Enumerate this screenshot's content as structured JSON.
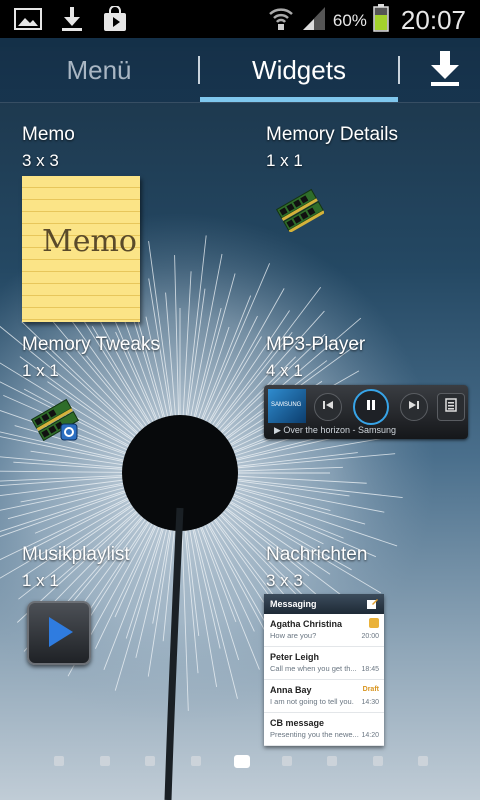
{
  "status_bar": {
    "battery_percent": "60%",
    "time": "20:07",
    "icons": [
      "gallery-icon",
      "download-icon",
      "store-bag-icon",
      "wifi-icon",
      "signal-icon",
      "battery-icon"
    ]
  },
  "tabs": [
    {
      "label": "Menü",
      "active": false
    },
    {
      "label": "Widgets",
      "active": true
    }
  ],
  "widgets": [
    {
      "title": "Memo",
      "size": "3 x 3",
      "preview_text": "Memo"
    },
    {
      "title": "Memory Details",
      "size": "1 x 1"
    },
    {
      "title": "Memory Tweaks",
      "size": "1 x 1"
    },
    {
      "title": "MP3-Player",
      "size": "4 x 1",
      "album_label": "SAMSUNG",
      "now_playing": "▶ Over the horizon - Samsung"
    },
    {
      "title": "Musikplaylist",
      "size": "1 x 1"
    },
    {
      "title": "Nachrichten",
      "size": "3 x 3",
      "app_title": "Messaging",
      "messages": [
        {
          "name": "Agatha Christina",
          "preview": "How are you?",
          "time": "20:00",
          "tag": ""
        },
        {
          "name": "Peter Leigh",
          "preview": "Call me when you get th...",
          "time": "18:45",
          "tag": ""
        },
        {
          "name": "Anna Bay",
          "preview": "I am not going to tell you.",
          "time": "14:30",
          "tag": "Draft"
        },
        {
          "name": "CB message",
          "preview": "Presenting you the newe...",
          "time": "14:20",
          "tag": ""
        }
      ]
    }
  ],
  "pager": {
    "page_count": 9,
    "active_index": 4
  },
  "colors": {
    "tab_indicator": "#7fc7ee",
    "memo_paper": "#fbe487",
    "mp3_play_ring": "#37a4e8"
  }
}
